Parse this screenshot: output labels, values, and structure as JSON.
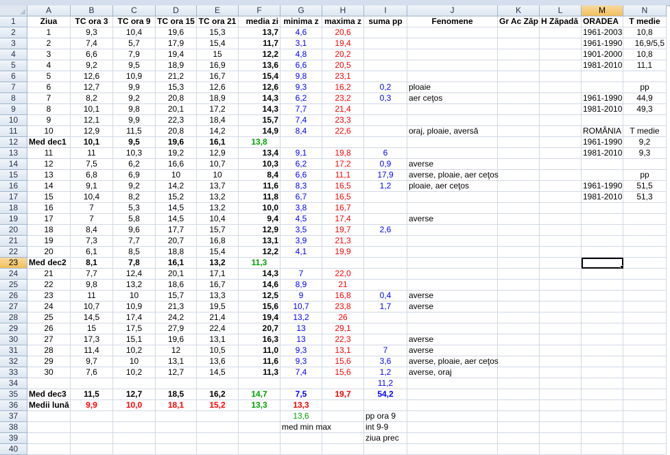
{
  "columns": [
    "A",
    "B",
    "C",
    "D",
    "E",
    "F",
    "G",
    "H",
    "I",
    "J",
    "K",
    "L",
    "M",
    "N"
  ],
  "selected_cell": {
    "row": 23,
    "col": "M"
  },
  "colors": {
    "blue": "#0000ff",
    "red": "#ff0000",
    "green": "#00a000",
    "grid": "#d0d7e5",
    "header": "#dde6f0",
    "selected_header": "#f1c05c"
  },
  "rows": [
    {
      "n": 1,
      "cells": {
        "A": "Ziua",
        "B": "TC ora 3",
        "C": "TC ora 9",
        "D": "TC ora 15",
        "E": "TC ora 21",
        "F": "media zi",
        "G": "minima z",
        "H": "maxima z",
        "I": "suma pp",
        "J": "Fenomene",
        "K": "Gr Ac Zăp",
        "L": "H Zăpadă",
        "M": "ORADEA",
        "N": "T medie"
      }
    },
    {
      "n": 2,
      "cells": {
        "A": "1",
        "B": "9,3",
        "C": "10,4",
        "D": "19,6",
        "E": "15,3",
        "F": "13,7",
        "G": "4,6",
        "H": "20,6",
        "M": "1961-2003",
        "N": "10,8"
      }
    },
    {
      "n": 3,
      "cells": {
        "A": "2",
        "B": "7,4",
        "C": "5,7",
        "D": "17,9",
        "E": "15,4",
        "F": "11,7",
        "G": "3,1",
        "H": "19,4",
        "M": "1961-1990",
        "N": "16,9/5,5"
      }
    },
    {
      "n": 4,
      "cells": {
        "A": "3",
        "B": "6,6",
        "C": "7,9",
        "D": "19,4",
        "E": "15",
        "F": "12,2",
        "G": "4,8",
        "H": "20,2",
        "M": "1901-2000",
        "N": "10,8"
      }
    },
    {
      "n": 5,
      "cells": {
        "A": "4",
        "B": "9,2",
        "C": "9,5",
        "D": "18,9",
        "E": "16,9",
        "F": "13,6",
        "G": "6,6",
        "H": "20,5",
        "M": "1981-2010",
        "N": "11,1"
      }
    },
    {
      "n": 6,
      "cells": {
        "A": "5",
        "B": "12,6",
        "C": "10,9",
        "D": "21,2",
        "E": "16,7",
        "F": "15,4",
        "G": "9,8",
        "H": "23,1"
      }
    },
    {
      "n": 7,
      "cells": {
        "A": "6",
        "B": "12,7",
        "C": "9,9",
        "D": "15,3",
        "E": "12,6",
        "F": "12,6",
        "G": "9,3",
        "H": "16,2",
        "I": "0,2",
        "J": "ploaie",
        "N": "pp"
      }
    },
    {
      "n": 8,
      "cells": {
        "A": "7",
        "B": "8,2",
        "C": "9,2",
        "D": "20,8",
        "E": "18,9",
        "F": "14,3",
        "G": "6,2",
        "H": "23,2",
        "I": "0,3",
        "J": "aer ceţos",
        "M": "1961-1990",
        "N": "44,9"
      }
    },
    {
      "n": 9,
      "cells": {
        "A": "8",
        "B": "10,1",
        "C": "9,8",
        "D": "20,1",
        "E": "17,2",
        "F": "14,3",
        "G": "7,7",
        "H": "21,4",
        "M": "1981-2010",
        "N": "49,3"
      }
    },
    {
      "n": 10,
      "cells": {
        "A": "9",
        "B": "12,1",
        "C": "9,9",
        "D": "22,3",
        "E": "18,4",
        "F": "15,7",
        "G": "7,4",
        "H": "23,3"
      }
    },
    {
      "n": 11,
      "cells": {
        "A": "10",
        "B": "12,9",
        "C": "11,5",
        "D": "20,8",
        "E": "14,2",
        "F": "14,9",
        "G": "8,4",
        "H": "22,6",
        "J": "oraj, ploaie, aversă",
        "M": "ROMÂNIA",
        "N": "T medie"
      }
    },
    {
      "n": 12,
      "cells": {
        "A": "Med dec1",
        "B": "10,1",
        "C": "9,5",
        "D": "19,6",
        "E": "16,1",
        "F": "13,8",
        "M": "1961-1990",
        "N": "9,2"
      }
    },
    {
      "n": 13,
      "cells": {
        "A": "11",
        "B": "11",
        "C": "10,3",
        "D": "19,2",
        "E": "12,9",
        "F": "13,4",
        "G": "9,1",
        "H": "19,8",
        "I": "6",
        "M": "1981-2010",
        "N": "9,3"
      }
    },
    {
      "n": 14,
      "cells": {
        "A": "12",
        "B": "7,5",
        "C": "6,2",
        "D": "16,6",
        "E": "10,7",
        "F": "10,3",
        "G": "6,2",
        "H": "17,2",
        "I": "0,9",
        "J": "averse"
      }
    },
    {
      "n": 15,
      "cells": {
        "A": "13",
        "B": "6,8",
        "C": "6,9",
        "D": "10",
        "E": "10",
        "F": "8,4",
        "G": "6,6",
        "H": "11,1",
        "I": "17,9",
        "J": "averse, ploaie, aer ceţos",
        "N": "pp"
      }
    },
    {
      "n": 16,
      "cells": {
        "A": "14",
        "B": "9,1",
        "C": "9,2",
        "D": "14,2",
        "E": "13,7",
        "F": "11,6",
        "G": "8,3",
        "H": "16,5",
        "I": "1,2",
        "J": "ploaie, aer ceţos",
        "M": "1961-1990",
        "N": "51,5"
      }
    },
    {
      "n": 17,
      "cells": {
        "A": "15",
        "B": "10,4",
        "C": "8,2",
        "D": "15,2",
        "E": "13,2",
        "F": "11,8",
        "G": "6,7",
        "H": "16,5",
        "M": "1981-2010",
        "N": "51,3"
      }
    },
    {
      "n": 18,
      "cells": {
        "A": "16",
        "B": "7",
        "C": "5,3",
        "D": "14,5",
        "E": "13,2",
        "F": "10,0",
        "G": "3,8",
        "H": "16,7"
      }
    },
    {
      "n": 19,
      "cells": {
        "A": "17",
        "B": "7",
        "C": "5,8",
        "D": "14,5",
        "E": "10,4",
        "F": "9,4",
        "G": "4,5",
        "H": "17,4",
        "J": "averse"
      }
    },
    {
      "n": 20,
      "cells": {
        "A": "18",
        "B": "8,4",
        "C": "9,6",
        "D": "17,7",
        "E": "15,7",
        "F": "12,9",
        "G": "3,5",
        "H": "19,7",
        "I": "2,6"
      }
    },
    {
      "n": 21,
      "cells": {
        "A": "19",
        "B": "7,3",
        "C": "7,7",
        "D": "20,7",
        "E": "16,8",
        "F": "13,1",
        "G": "3,9",
        "H": "21,3"
      }
    },
    {
      "n": 22,
      "cells": {
        "A": "20",
        "B": "6,1",
        "C": "8,5",
        "D": "18,8",
        "E": "15,4",
        "F": "12,2",
        "G": "4,1",
        "H": "19,9"
      }
    },
    {
      "n": 23,
      "cells": {
        "A": "Med dec2",
        "B": "8,1",
        "C": "7,8",
        "D": "16,1",
        "E": "13,2",
        "F": "11,3"
      }
    },
    {
      "n": 24,
      "cells": {
        "A": "21",
        "B": "7,7",
        "C": "12,4",
        "D": "20,1",
        "E": "17,1",
        "F": "14,3",
        "G": "7",
        "H": "22,0"
      }
    },
    {
      "n": 25,
      "cells": {
        "A": "22",
        "B": "9,8",
        "C": "13,2",
        "D": "18,6",
        "E": "16,7",
        "F": "14,6",
        "G": "8,9",
        "H": "21"
      }
    },
    {
      "n": 26,
      "cells": {
        "A": "23",
        "B": "11",
        "C": "10",
        "D": "15,7",
        "E": "13,3",
        "F": "12,5",
        "G": "9",
        "H": "16,8",
        "I": "0,4",
        "J": "averse"
      }
    },
    {
      "n": 27,
      "cells": {
        "A": "24",
        "B": "10,7",
        "C": "10,9",
        "D": "21,3",
        "E": "19,5",
        "F": "15,6",
        "G": "10,7",
        "H": "23,8",
        "I": "1,7",
        "J": "averse"
      }
    },
    {
      "n": 28,
      "cells": {
        "A": "25",
        "B": "14,5",
        "C": "17,4",
        "D": "24,2",
        "E": "21,4",
        "F": "19,4",
        "G": "13,2",
        "H": "26"
      }
    },
    {
      "n": 29,
      "cells": {
        "A": "26",
        "B": "15",
        "C": "17,5",
        "D": "27,9",
        "E": "22,4",
        "F": "20,7",
        "G": "13",
        "H": "29,1"
      }
    },
    {
      "n": 30,
      "cells": {
        "A": "27",
        "B": "17,3",
        "C": "15,1",
        "D": "19,6",
        "E": "13,1",
        "F": "16,3",
        "G": "13",
        "H": "22,3",
        "J": "averse"
      }
    },
    {
      "n": 31,
      "cells": {
        "A": "28",
        "B": "11,4",
        "C": "10,2",
        "D": "12",
        "E": "10,5",
        "F": "11,0",
        "G": "9,3",
        "H": "13,1",
        "I": "7",
        "J": "averse"
      }
    },
    {
      "n": 32,
      "cells": {
        "A": "29",
        "B": "9,7",
        "C": "10",
        "D": "13,1",
        "E": "13,6",
        "F": "11,6",
        "G": "9,3",
        "H": "15,6",
        "I": "3,6",
        "J": "averse, ploaie, aer ceţos"
      }
    },
    {
      "n": 33,
      "cells": {
        "A": "30",
        "B": "7,6",
        "C": "10,2",
        "D": "12,7",
        "E": "14,5",
        "F": "11,3",
        "G": "7,4",
        "H": "15,6",
        "I": "1,2",
        "J": "averse, oraj"
      }
    },
    {
      "n": 34,
      "cells": {
        "I": "11,2"
      }
    },
    {
      "n": 35,
      "cells": {
        "A": "Med dec3",
        "B": "11,5",
        "C": "12,7",
        "D": "18,5",
        "E": "16,2",
        "F": "14,7",
        "G": "7,5",
        "H": "19,7",
        "I": "54,2"
      }
    },
    {
      "n": 36,
      "cells": {
        "A": "Medii lună",
        "B": "9,9",
        "C": "10,0",
        "D": "18,1",
        "E": "15,2",
        "F": "13,3",
        "G": "13,3"
      }
    },
    {
      "n": 37,
      "cells": {
        "G": "13,6",
        "I": "pp ora 9"
      }
    },
    {
      "n": 38,
      "cells": {
        "G": "med min max",
        "I": "int 9-9"
      }
    },
    {
      "n": 39,
      "cells": {
        "I": "ziua prec"
      }
    },
    {
      "n": 40,
      "cells": {}
    }
  ]
}
